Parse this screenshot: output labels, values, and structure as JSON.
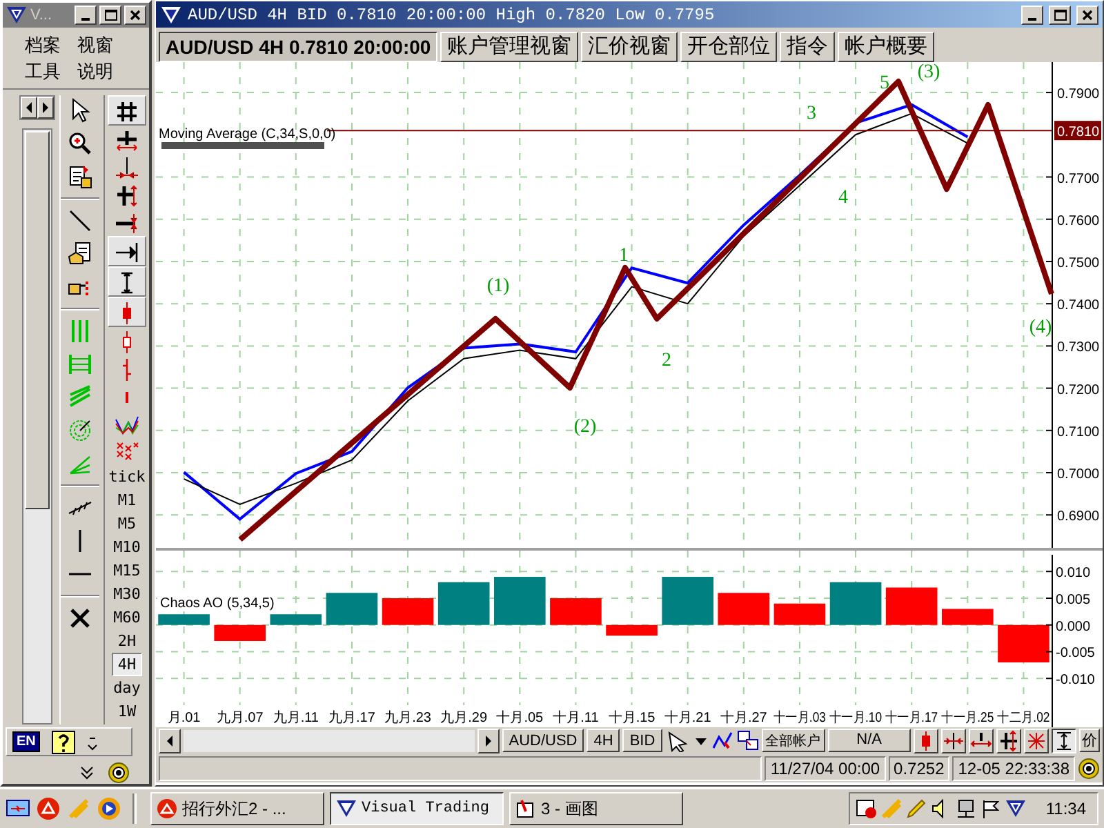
{
  "app": {
    "title": "V...",
    "menu": [
      "档案",
      "视窗",
      "工具",
      "说明"
    ],
    "language": "EN"
  },
  "timeframes": [
    {
      "label": "tick",
      "selected": false
    },
    {
      "label": "M1",
      "selected": false
    },
    {
      "label": "M5",
      "selected": false
    },
    {
      "label": "M10",
      "selected": false
    },
    {
      "label": "M15",
      "selected": false
    },
    {
      "label": "M30",
      "selected": false
    },
    {
      "label": "M60",
      "selected": false
    },
    {
      "label": "2H",
      "selected": false
    },
    {
      "label": "4H",
      "selected": true
    },
    {
      "label": "day",
      "selected": false
    },
    {
      "label": "1W",
      "selected": false
    }
  ],
  "chart_window": {
    "title": "AUD/USD 4H BID 0.7810 20:00:00 High 0.7820 Low 0.7795",
    "tabs": [
      {
        "label": "AUD/USD 4H 0.7810 20:00:00",
        "selected": true
      },
      {
        "label": "账户管理视窗",
        "selected": false
      },
      {
        "label": "汇价视窗",
        "selected": false
      },
      {
        "label": "开仓部位",
        "selected": false
      },
      {
        "label": "指令",
        "selected": false
      },
      {
        "label": "帐户概要",
        "selected": false
      }
    ],
    "price_panel": {
      "current_price": "0.7810",
      "wave_labels": [
        "(1)",
        "1",
        "(2)",
        "2",
        "3",
        "4",
        "5",
        "(3)",
        "(4)"
      ],
      "chart_data": {
        "type": "line",
        "categories": [
          null,
          null,
          null,
          null,
          null,
          null,
          null,
          null,
          null,
          null,
          null,
          null,
          null,
          null,
          null
        ],
        "series": [
          {
            "color": "#0000ff",
            "values": [
              0.7001,
              0.689,
              0.6998,
              0.705,
              0.7201,
              0.7295,
              0.7305,
              0.7286,
              0.7485,
              0.7449,
              0.7586,
              0.7704,
              0.7828,
              0.7871,
              0.7795
            ]
          },
          {
            "name": "Moving Average (C,34,S,0,0)",
            "color": "#000000",
            "values": [
              0.6985,
              0.6925,
              0.6975,
              0.703,
              0.717,
              0.727,
              0.729,
              0.727,
              0.744,
              0.74,
              0.756,
              0.768,
              0.78,
              0.785,
              0.778
            ]
          }
        ],
        "grid": true,
        "ylim": [
          0.6822,
          0.7972
        ],
        "yticks": [
          {
            "value": 0.79,
            "label": "0.7900"
          },
          {
            "value": 0.77,
            "label": "0.7700"
          },
          {
            "value": 0.76,
            "label": "0.7600"
          },
          {
            "value": 0.75,
            "label": "0.7500"
          },
          {
            "value": 0.74,
            "label": "0.7400"
          },
          {
            "value": 0.73,
            "label": "0.7300"
          },
          {
            "value": 0.72,
            "label": "0.7200"
          },
          {
            "value": 0.71,
            "label": "0.7100"
          },
          {
            "value": 0.7,
            "label": "0.7000"
          },
          {
            "value": 0.69,
            "label": "0.6900"
          }
        ]
      }
    },
    "oscillator_panel": {
      "chart_data": {
        "type": "bar",
        "title": "Chaos AO (5,34,5)",
        "categories": [
          "月.01",
          "九月.07",
          "九月.11",
          "九月.17",
          "九月.23",
          "九月.29",
          "十月.05",
          "十月.11",
          "十月.15",
          "十月.21",
          "十月.27",
          "十一月.03",
          "十一月.10",
          "十一月.17",
          "十一月.25",
          "十二月.02"
        ],
        "series": [
          {
            "color": "#008080",
            "values": [
              0.002,
              null,
              0.002,
              0.006,
              null,
              0.008,
              0.009,
              null,
              null,
              0.009,
              null,
              null,
              0.008,
              null,
              null,
              null
            ]
          },
          {
            "color": "#ff0000",
            "values": [
              null,
              -0.003,
              null,
              null,
              0.005,
              null,
              null,
              0.005,
              -0.002,
              null,
              0.006,
              0.004,
              null,
              0.007,
              0.003,
              -0.007
            ]
          }
        ],
        "stacked": true,
        "grid": true,
        "ylim": [
          -0.015,
          0.0139
        ],
        "yticks": [
          {
            "value": 0.01,
            "label": "0.010"
          },
          {
            "value": 0.005,
            "label": "0.005"
          },
          {
            "value": 0,
            "label": "0.000"
          },
          {
            "value": -0.005,
            "label": "-0.005"
          },
          {
            "value": -0.01,
            "label": "-0.010"
          }
        ]
      }
    },
    "toolbar": {
      "buttons": [
        "AUD/USD",
        "4H",
        "BID"
      ],
      "account": "全部帐户",
      "account_value": "N/A",
      "price_label": "价"
    },
    "status_bar": {
      "cursor_time": "11/27/04 00:00",
      "cursor_price": "0.7252",
      "clock": "12-05 22:33:38"
    }
  },
  "taskbar": {
    "windows": [
      {
        "label": "招行外汇2 - ...",
        "selected": false
      },
      {
        "label": "Visual Trading",
        "selected": true
      },
      {
        "label": "3 - 画图",
        "selected": false
      }
    ],
    "clock": "11:34"
  }
}
